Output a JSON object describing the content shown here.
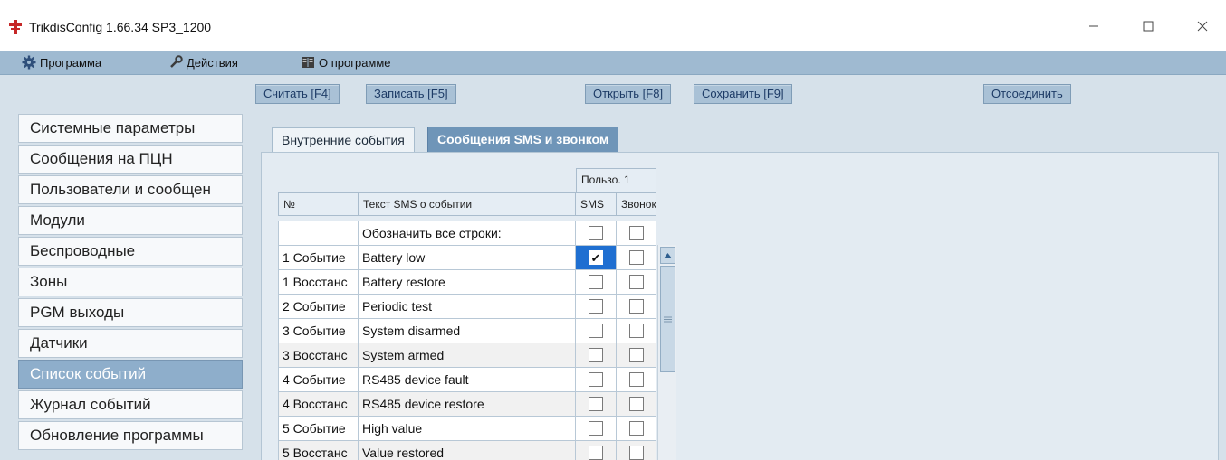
{
  "window": {
    "title": "TrikdisConfig 1.66.34   SP3_1200",
    "controls": [
      "minimize",
      "maximize",
      "close"
    ]
  },
  "menu": [
    {
      "label": "Программа",
      "icon": "gear-icon"
    },
    {
      "label": "Действия",
      "icon": "wrench-icon"
    },
    {
      "label": "О программе",
      "icon": "book-icon"
    }
  ],
  "toolbar": {
    "read": "Считать [F4]",
    "write": "Записать [F5]",
    "open": "Открыть [F8]",
    "save": "Сохранить [F9]",
    "disconnect": "Отсоединить"
  },
  "sidebar": {
    "items": [
      "Системные параметры",
      "Сообщения на ПЦН",
      "Пользователи и сообщен",
      "Модули",
      "Беспроводные",
      "Зоны",
      "PGM выходы",
      "Датчики",
      "Список событий",
      "Журнал событий",
      "Обновление программы"
    ],
    "active_index": 8
  },
  "tabs": {
    "internal": "Внутренние события",
    "sms_calls": "Сообщения SMS и звонком",
    "active": "sms_calls"
  },
  "grid": {
    "group_header": "Пользо. 1",
    "headers": {
      "num": "№",
      "text": "Текст SMS о событии",
      "sms": "SMS",
      "call": "Звонок"
    },
    "mark_all": "Обозначить все строки:",
    "rows": [
      {
        "num": "1 Событие",
        "text": "Battery low",
        "sms": true,
        "call": false
      },
      {
        "num": "1 Восстанс",
        "text": "Battery restore",
        "sms": false,
        "call": false
      },
      {
        "num": "2 Событие",
        "text": "Periodic test",
        "sms": false,
        "call": false
      },
      {
        "num": "3 Событие",
        "text": "System disarmed",
        "sms": false,
        "call": false
      },
      {
        "num": "3 Восстанс",
        "text": "System armed",
        "sms": false,
        "call": false
      },
      {
        "num": "4 Событие",
        "text": "RS485 device fault",
        "sms": false,
        "call": false
      },
      {
        "num": "4 Восстанс",
        "text": "RS485 device restore",
        "sms": false,
        "call": false
      },
      {
        "num": "5 Событие",
        "text": "High value",
        "sms": false,
        "call": false
      },
      {
        "num": "5 Восстанс",
        "text": "Value restored",
        "sms": false,
        "call": false
      }
    ]
  },
  "colors": {
    "menubar": "#9fbad1",
    "active_tab": "#6f95b8",
    "active_sidebar": "#8eaecb",
    "selection": "#1f6fd1"
  }
}
